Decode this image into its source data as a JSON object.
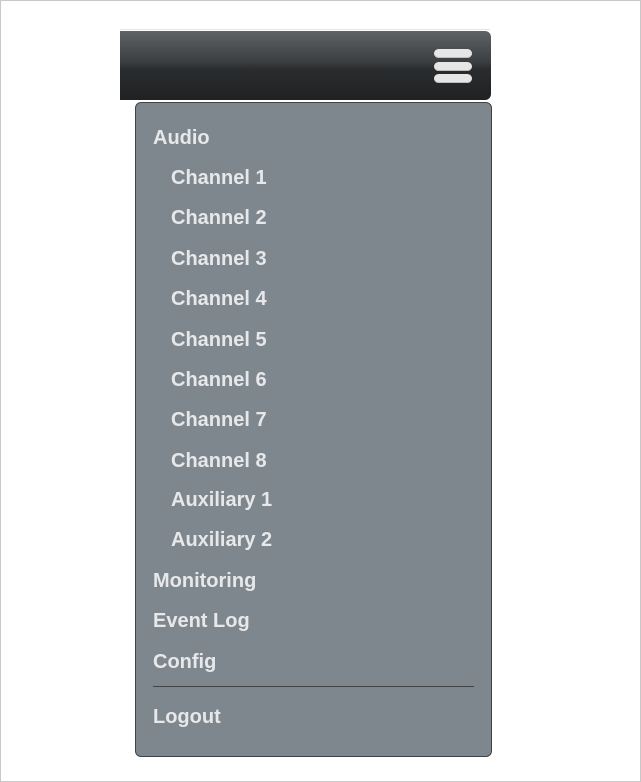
{
  "toolbar": {
    "menu_icon": "hamburger-menu-icon"
  },
  "menu": {
    "audio": "Audio",
    "channels": [
      "Channel 1",
      "Channel 2",
      "Channel 3",
      "Channel 4",
      "Channel 5",
      "Channel 6",
      "Channel 7",
      "Channel 8"
    ],
    "auxiliary": [
      "Auxiliary 1",
      "Auxiliary 2"
    ],
    "monitoring": "Monitoring",
    "event_log": "Event Log",
    "config": "Config",
    "logout": "Logout"
  },
  "colors": {
    "menu_background": "#7f878e",
    "menu_text": "#e6e8ea",
    "navbar_dark": "#1f2123"
  }
}
